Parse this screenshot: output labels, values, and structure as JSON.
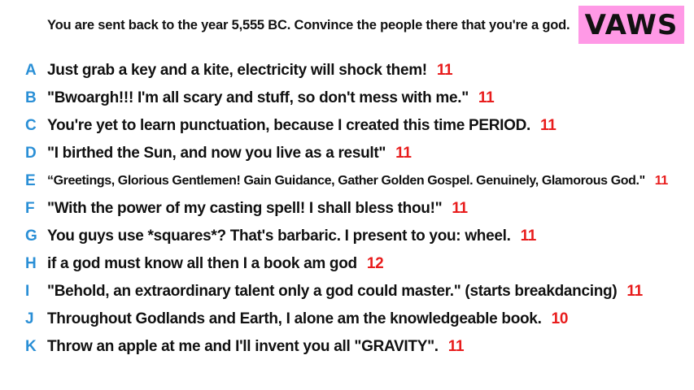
{
  "prompt": "You are sent back to the year 5,555 BC. Convince the people there that you're a god.",
  "badge": "VAWS",
  "colors": {
    "badge_bg": "#ff99e6",
    "letter": "#2a8fd6",
    "score": "#e81c1c"
  },
  "answers": [
    {
      "letter": "A",
      "text": "Just grab a key and a kite, electricity will shock them!",
      "score": "11"
    },
    {
      "letter": "B",
      "text": "\"Bwoargh!!! I'm all scary and stuff, so don't mess with me.\"",
      "score": "11"
    },
    {
      "letter": "C",
      "text": "You're yet to learn punctuation, because I created this time PERIOD.",
      "score": "11"
    },
    {
      "letter": "D",
      "text": "\"I birthed the Sun, and now you live as a result\"",
      "score": "11"
    },
    {
      "letter": "E",
      "text": "“Greetings, Glorious Gentlemen! Gain Guidance, Gather Golden Gospel. Genuinely, Glamorous God.\"",
      "score": "11"
    },
    {
      "letter": "F",
      "text": "\"With the power of my casting spell! I shall bless thou!\"",
      "score": "11"
    },
    {
      "letter": "G",
      "text": "You guys use *squares*? That's barbaric. I present to you: wheel.",
      "score": "11"
    },
    {
      "letter": "H",
      "text": "if a god must know all then I a book am god",
      "score": "12"
    },
    {
      "letter": "I",
      "text": "\"Behold, an extraordinary talent only a god could master.\" (starts breakdancing)",
      "score": "11"
    },
    {
      "letter": "J",
      "text": "Throughout Godlands and Earth, I alone am the knowledgeable book.",
      "score": "10"
    },
    {
      "letter": "K",
      "text": "Throw an apple at me and I'll invent you all \"GRAVITY\".",
      "score": "11"
    }
  ]
}
